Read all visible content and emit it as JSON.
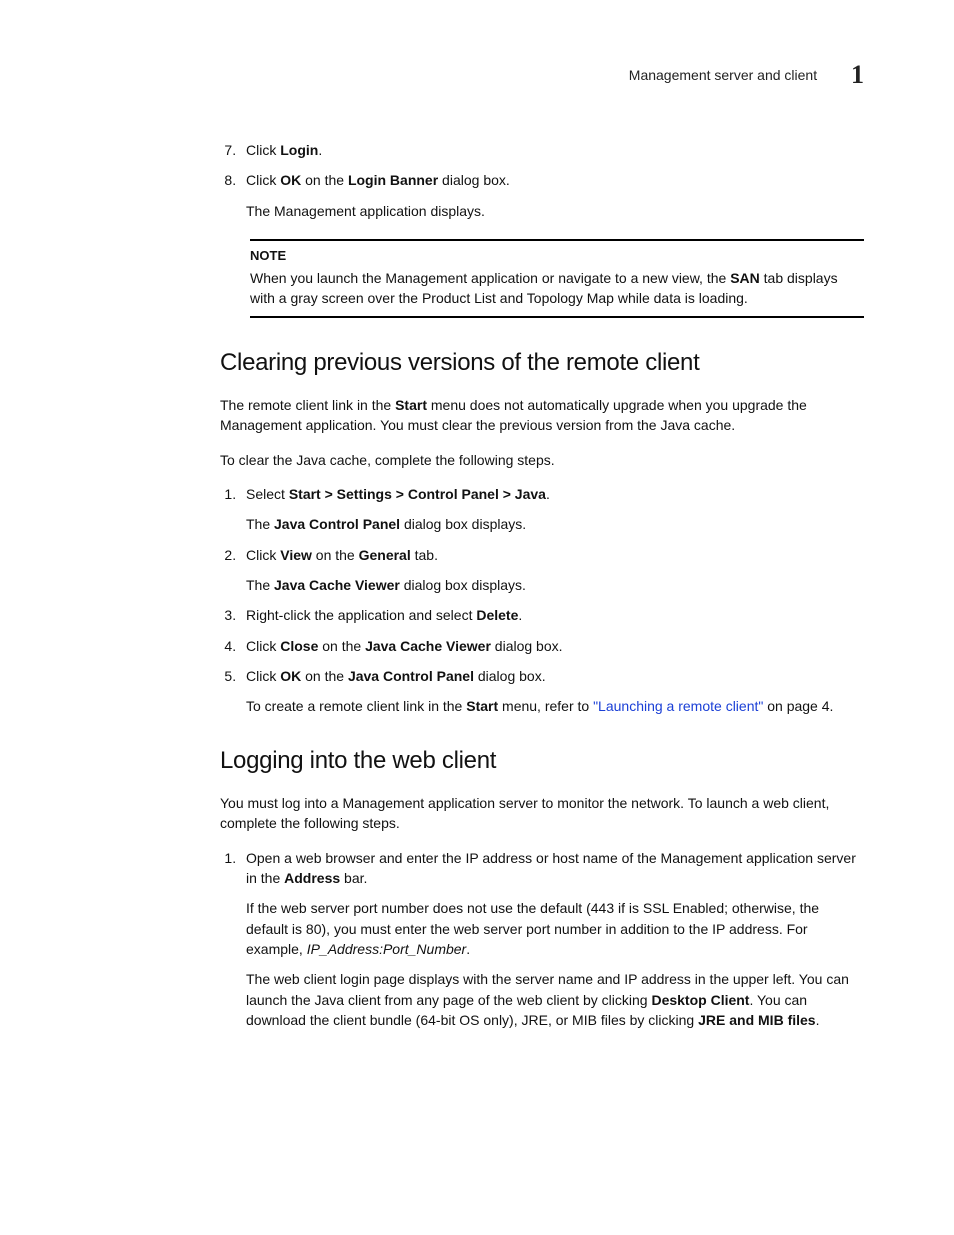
{
  "header": {
    "running_title": "Management server and client",
    "chapter_number": "1"
  },
  "top_steps": {
    "start": 7,
    "items": [
      {
        "pre": "Click ",
        "bold": "Login",
        "post": "."
      },
      {
        "pre": "Click ",
        "bold1": "OK",
        "mid1": " on the ",
        "bold2": "Login Banner",
        "post": " dialog box.",
        "sub": "The Management application displays."
      }
    ]
  },
  "note": {
    "label": "NOTE",
    "text_pre": "When you launch the Management application or navigate to a new view, the ",
    "bold": "SAN",
    "text_post": " tab displays with a gray screen over the Product List and Topology Map while data is loading."
  },
  "section1": {
    "title": "Clearing previous versions of the remote client",
    "intro_pre": "The remote client link in the ",
    "intro_bold": "Start",
    "intro_post": " menu does not automatically upgrade when you upgrade the Management application. You must clear the previous version from the Java cache.",
    "lead": "To clear the Java cache, complete the following steps.",
    "steps": [
      {
        "pre": "Select ",
        "bold": "Start > Settings > Control Panel > Java",
        "post": ".",
        "sub_pre": "The ",
        "sub_bold": "Java Control Panel",
        "sub_post": " dialog box displays."
      },
      {
        "pre": "Click ",
        "bold1": "View",
        "mid": " on the ",
        "bold2": "General",
        "post": " tab.",
        "sub_pre": "The ",
        "sub_bold": "Java Cache Viewer",
        "sub_post": " dialog box displays."
      },
      {
        "pre": "Right-click the application and select ",
        "bold": "Delete",
        "post": "."
      },
      {
        "pre": "Click ",
        "bold1": "Close",
        "mid": " on the ",
        "bold2": "Java Cache Viewer",
        "post": " dialog box."
      },
      {
        "pre": "Click ",
        "bold1": "OK",
        "mid": " on the ",
        "bold2": "Java Control Panel",
        "post": " dialog box.",
        "sub_pre": "To create a remote client link in the ",
        "sub_bold": "Start",
        "sub_mid": " menu, refer to ",
        "sub_link": "\"Launching a remote client\"",
        "sub_post": " on page 4."
      }
    ]
  },
  "section2": {
    "title": "Logging into the web client",
    "intro": "You must log into a Management application server to monitor the network. To launch a web client, complete the following steps.",
    "steps": [
      {
        "pre": "Open a web browser and enter the IP address or host name of the Management application server in the ",
        "bold": "Address",
        "post": " bar.",
        "para2_pre": "If the web server port number does not use the default (443 if is SSL Enabled; otherwise, the default is 80), you must enter the web server port number in addition to the IP address. For example, ",
        "para2_italic": "IP_Address:Port_Number",
        "para2_post": ".",
        "para3_pre": "The web client login page displays with the server name and IP address in the upper left. You can launch the Java client from any page of the web client by clicking ",
        "para3_bold1": "Desktop Client",
        "para3_mid": ". You can download the client bundle (64-bit OS only), JRE, or MIB files by clicking ",
        "para3_bold2": "JRE and MIB files",
        "para3_post": "."
      }
    ]
  }
}
